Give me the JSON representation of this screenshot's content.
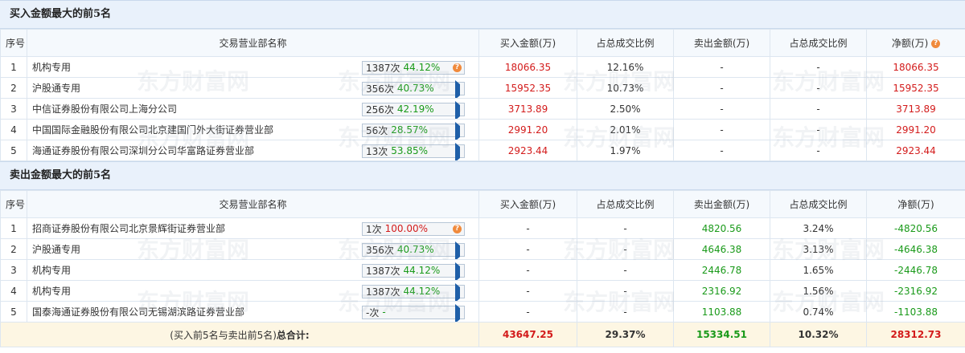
{
  "buy_section": {
    "title": "买入金额最大的前5名",
    "headers": [
      "序号",
      "交易营业部名称",
      "买入金额(万)",
      "占总成交比例",
      "卖出金额(万)",
      "占总成交比例",
      "净额(万)"
    ],
    "rows": [
      {
        "idx": "1",
        "name": "机构专用",
        "count": "1387次",
        "pct": "44.12%",
        "btn": "q",
        "buy": "18066.35",
        "buy_ratio": "12.16%",
        "sell": "-",
        "sell_ratio": "-",
        "net": "18066.35"
      },
      {
        "idx": "2",
        "name": "沪股通专用",
        "count": "356次",
        "pct": "40.73%",
        "btn": "arrow",
        "buy": "15952.35",
        "buy_ratio": "10.73%",
        "sell": "-",
        "sell_ratio": "-",
        "net": "15952.35"
      },
      {
        "idx": "3",
        "name": "中信证券股份有限公司上海分公司",
        "count": "256次",
        "pct": "42.19%",
        "btn": "arrow",
        "buy": "3713.89",
        "buy_ratio": "2.50%",
        "sell": "-",
        "sell_ratio": "-",
        "net": "3713.89"
      },
      {
        "idx": "4",
        "name": "中国国际金融股份有限公司北京建国门外大街证券营业部",
        "count": "56次",
        "pct": "28.57%",
        "btn": "arrow",
        "buy": "2991.20",
        "buy_ratio": "2.01%",
        "sell": "-",
        "sell_ratio": "-",
        "net": "2991.20"
      },
      {
        "idx": "5",
        "name": "海通证券股份有限公司深圳分公司华富路证券营业部",
        "count": "13次",
        "pct": "53.85%",
        "btn": "arrow",
        "buy": "2923.44",
        "buy_ratio": "1.97%",
        "sell": "-",
        "sell_ratio": "-",
        "net": "2923.44"
      }
    ]
  },
  "sell_section": {
    "title": "卖出金额最大的前5名",
    "headers": [
      "序号",
      "交易营业部名称",
      "买入金额(万)",
      "占总成交比例",
      "卖出金额(万)",
      "占总成交比例",
      "净额(万)"
    ],
    "rows": [
      {
        "idx": "1",
        "name": "招商证券股份有限公司北京景辉街证券营业部",
        "count": "1次",
        "pct": "100.00%",
        "btn": "q",
        "buy": "-",
        "buy_ratio": "-",
        "sell": "4820.56",
        "sell_ratio": "3.24%",
        "net": "-4820.56"
      },
      {
        "idx": "2",
        "name": "沪股通专用",
        "count": "356次",
        "pct": "40.73%",
        "btn": "arrow",
        "buy": "-",
        "buy_ratio": "-",
        "sell": "4646.38",
        "sell_ratio": "3.13%",
        "net": "-4646.38"
      },
      {
        "idx": "3",
        "name": "机构专用",
        "count": "1387次",
        "pct": "44.12%",
        "btn": "arrow",
        "buy": "-",
        "buy_ratio": "-",
        "sell": "2446.78",
        "sell_ratio": "1.65%",
        "net": "-2446.78"
      },
      {
        "idx": "4",
        "name": "机构专用",
        "count": "1387次",
        "pct": "44.12%",
        "btn": "arrow",
        "buy": "-",
        "buy_ratio": "-",
        "sell": "2316.92",
        "sell_ratio": "1.56%",
        "net": "-2316.92"
      },
      {
        "idx": "5",
        "name": "国泰海通证券股份有限公司无锡湖滨路证券营业部",
        "count": "-次",
        "pct": "-",
        "btn": "arrow",
        "buy": "-",
        "buy_ratio": "-",
        "sell": "1103.88",
        "sell_ratio": "0.74%",
        "net": "-1103.88"
      }
    ]
  },
  "total": {
    "label_prefix": "(买入前5名与卖出前5名)",
    "label_bold": "总合计:",
    "buy": "43647.25",
    "buy_ratio": "29.37%",
    "sell": "15334.51",
    "sell_ratio": "10.32%",
    "net": "28312.73"
  },
  "watermark": {
    "text": "东方财富网"
  },
  "colors": {
    "header_bg": "#e9f1fb",
    "red": "#d31b1b",
    "green": "#1a9a1a",
    "total_bg": "#fdf6e3",
    "accent_icon": "#f08a3c"
  }
}
